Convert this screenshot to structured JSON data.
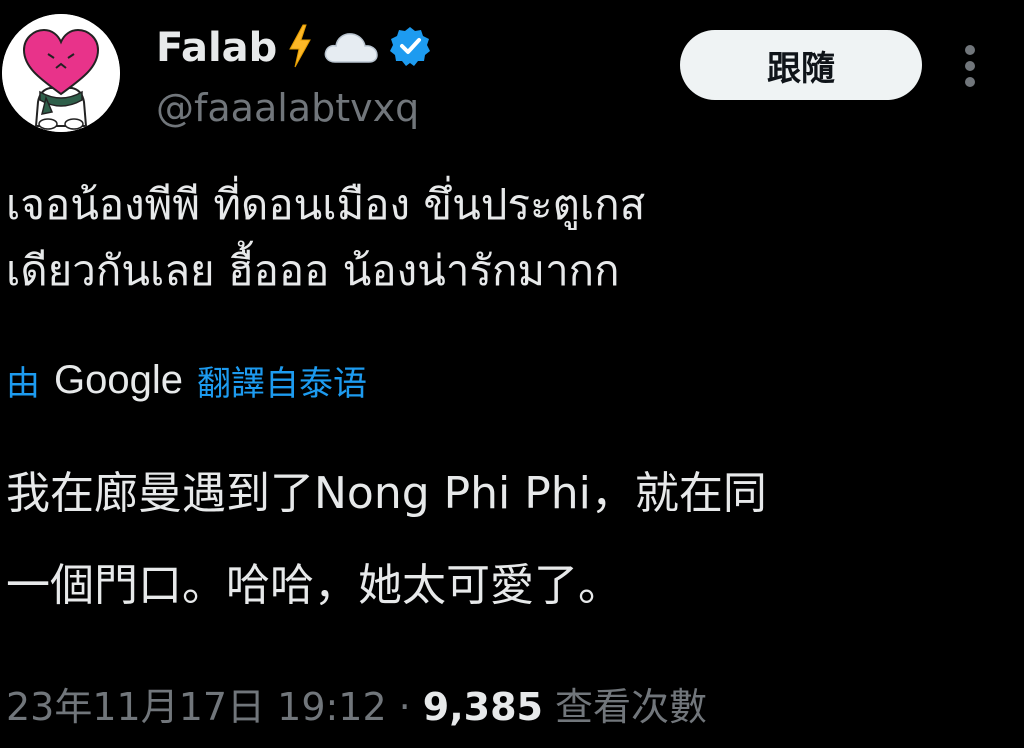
{
  "author": {
    "display_name": "Falab",
    "handle": "@faaalabtvxq",
    "emoji_icons": [
      "lightning-icon",
      "cloud-icon"
    ],
    "verified": true,
    "verified_color": "#1d9bf0"
  },
  "follow_button": {
    "label": "跟隨"
  },
  "tweet": {
    "text_line1": "เจอน้องพีพี ที่ดอนเมือง ขึ่นประตูเกส",
    "text_line2": "เดียวกันเลย ฮื้อออ น้องน่ารักมากก"
  },
  "translation": {
    "by_label": "由",
    "provider": "Google",
    "link_label": "翻譯自泰语",
    "text_line1": "我在廊曼遇到了Nong Phi Phi，就在同",
    "text_line2": "一個門口。哈哈，她太可愛了。"
  },
  "meta": {
    "timestamp": "23年11月17日 19:12",
    "separator": "·",
    "views_count": "9,385",
    "views_label": "查看次數"
  },
  "colors": {
    "background": "#000000",
    "text_primary": "#e7e9ea",
    "text_secondary": "#71767b",
    "accent": "#1d9bf0",
    "avatar_heart": "#e8338a"
  }
}
